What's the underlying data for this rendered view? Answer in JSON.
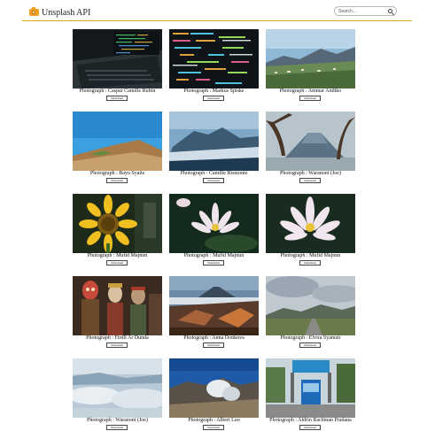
{
  "app": {
    "title": "Unsplash API"
  },
  "search": {
    "placeholder": "Search..."
  },
  "photos": [
    {
      "credit": "Photograph : Caspar Camille Rubin",
      "download_label": "Download"
    },
    {
      "credit": "Photograph : Markus Spiske",
      "download_label": "Download"
    },
    {
      "credit": "Photograph : Ammar Andiko",
      "download_label": "Download"
    },
    {
      "credit": "Photograph : Bayu Syaits",
      "download_label": "Download"
    },
    {
      "credit": "Photograph : Camille Bismonte",
      "download_label": "Download"
    },
    {
      "credit": "Photograph : Waranont (Joe)",
      "download_label": "Download"
    },
    {
      "credit": "Photograph : Mufid Majnun",
      "download_label": "Download"
    },
    {
      "credit": "Photograph : Mufid Majnun",
      "download_label": "Download"
    },
    {
      "credit": "Photograph : Mufid Majnun",
      "download_label": "Download"
    },
    {
      "credit": "Photograph : Firdll Ar Dunda",
      "download_label": "Download"
    },
    {
      "credit": "Photograph : Anna Donkova",
      "download_label": "Download"
    },
    {
      "credit": "Photograph : Elvira Syamsir",
      "download_label": "Download"
    },
    {
      "credit": "Photograph : Waranont (Joe)",
      "download_label": "Download"
    },
    {
      "credit": "Photograph : Albert Luo",
      "download_label": "Download"
    },
    {
      "credit": "Photograph : Aldrin Rachman Pradana",
      "download_label": "Download"
    }
  ]
}
